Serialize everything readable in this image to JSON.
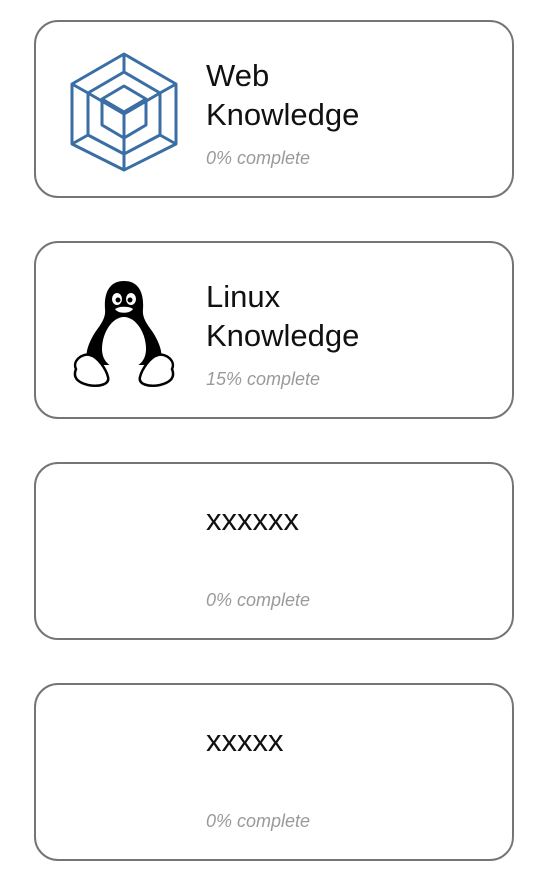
{
  "courses": [
    {
      "title": "Web\nKnowledge",
      "progress": "0% complete",
      "progress_value": 0,
      "icon": "cube-icon",
      "icon_color": "#3a6ea5"
    },
    {
      "title": "Linux\nKnowledge",
      "progress": "15% complete",
      "progress_value": 15,
      "icon": "tux-penguin-icon"
    },
    {
      "title": "xxxxxx",
      "progress": "0% complete",
      "progress_value": 0
    },
    {
      "title": "xxxxx",
      "progress": "0% complete",
      "progress_value": 0
    }
  ],
  "colors": {
    "card_border": "#757575",
    "title_text": "#111111",
    "progress_text": "#9a9a9a"
  }
}
